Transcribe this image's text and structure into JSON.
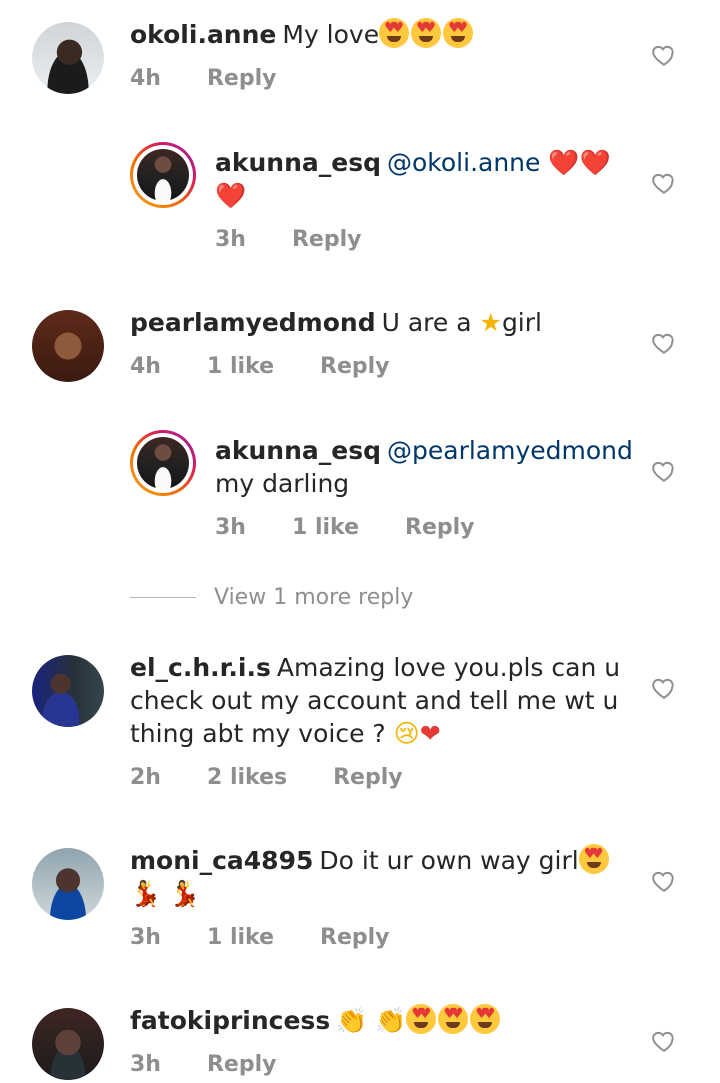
{
  "comments": [
    {
      "username": "okoli.anne",
      "text": "My love",
      "emojis": [
        "heart-eyes",
        "heart-eyes",
        "heart-eyes"
      ],
      "time": "4h",
      "reply": "Reply"
    },
    {
      "username": "akunna_esq",
      "mention": "@okoli.anne",
      "text_suffix": "❤️❤️❤️",
      "time": "3h",
      "reply": "Reply"
    },
    {
      "username": "pearlamyedmond",
      "text_pre": "U are a",
      "text_post": "girl",
      "time": "4h",
      "likes": "1 like",
      "reply": "Reply"
    },
    {
      "username": "akunna_esq",
      "mention": "@pearlamyedmond",
      "text": "my darling",
      "time": "3h",
      "likes": "1 like",
      "reply": "Reply"
    },
    {
      "username": "el_c.h.r.i.s",
      "text": "Amazing love you.pls can u check out my account and tell me wt u thing abt my voice ?",
      "time": "2h",
      "likes": "2 likes",
      "reply": "Reply"
    },
    {
      "username": "moni_ca4895",
      "text": "Do it ur own way girl",
      "time": "3h",
      "likes": "1 like",
      "reply": "Reply"
    },
    {
      "username": "fatokiprincess",
      "time": "3h",
      "reply": "Reply"
    }
  ],
  "view_more": "View 1 more reply",
  "icons": {
    "like": "heart-outline-icon"
  },
  "colors": {
    "text": "#262626",
    "meta": "#8e8e8e",
    "mention": "#00376b"
  }
}
